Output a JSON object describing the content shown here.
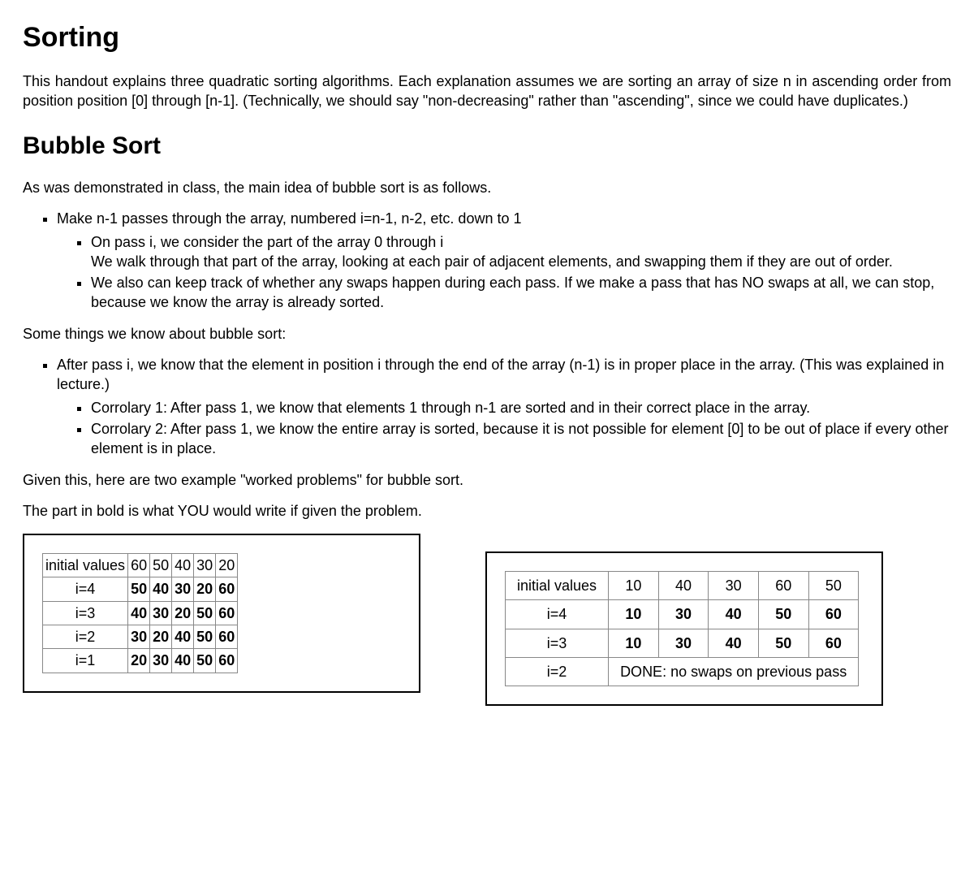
{
  "headings": {
    "main": "Sorting",
    "bubble": "Bubble Sort"
  },
  "paras": {
    "intro": "This handout explains three quadratic sorting algorithms. Each explanation assumes we are sorting an array of size n in ascending order from position position [0] through [n-1]. (Technically, we should say \"non-decreasing\" rather than \"ascending\", since we could have duplicates.)",
    "bubble_intro": "As was demonstrated in class, the main idea of bubble sort is as follows.",
    "bubble_know": "Some things we know about bubble sort:",
    "examples_intro": "Given this, here are two example \"worked problems\" for bubble sort.",
    "bold_note": "The part in bold is what YOU would write if given the problem."
  },
  "list1": {
    "item1": "Make n-1 passes through the array, numbered i=n-1, n-2, etc. down to 1",
    "sub1a": "On pass i, we consider the part of the array 0 through i",
    "sub1a_cont": "We walk through that part of the array, looking at each pair of adjacent elements, and swapping them if they are out of order.",
    "sub1b": "We also can keep track of whether any swaps happen during each pass. If we make a pass that has NO swaps at all, we can stop, because we know the array is already sorted."
  },
  "list2": {
    "item1": "After pass i, we know that the element in position i through the end of the array (n-1) is in proper place in the array. (This was explained in lecture.)",
    "sub1a": "Corrolary 1: After pass 1, we know that elements 1 through n-1 are sorted and in their correct place in the array.",
    "sub1b": "Corrolary 2: After pass 1, we know the entire array is sorted, because it is not possible for element [0] to be out of place if every other element is in place."
  },
  "table_left": {
    "initial_label": "initial values",
    "initial": [
      "60",
      "50",
      "40",
      "30",
      "20"
    ],
    "rows": [
      {
        "label": "i=4",
        "vals": [
          "50",
          "40",
          "30",
          "20",
          "60"
        ],
        "bold": true
      },
      {
        "label": "i=3",
        "vals": [
          "40",
          "30",
          "20",
          "50",
          "60"
        ],
        "bold": true
      },
      {
        "label": "i=2",
        "vals": [
          "30",
          "20",
          "40",
          "50",
          "60"
        ],
        "bold": true
      },
      {
        "label": "i=1",
        "vals": [
          "20",
          "30",
          "40",
          "50",
          "60"
        ],
        "bold": true
      }
    ]
  },
  "table_right": {
    "initial_label": "initial values",
    "initial": [
      "10",
      "40",
      "30",
      "60",
      "50"
    ],
    "rows": [
      {
        "label": "i=4",
        "vals": [
          "10",
          "30",
          "40",
          "50",
          "60"
        ],
        "bold": true
      },
      {
        "label": "i=3",
        "vals": [
          "10",
          "30",
          "40",
          "50",
          "60"
        ],
        "bold": true
      }
    ],
    "done_label": "i=2",
    "done_text": "DONE: no swaps on previous pass"
  }
}
